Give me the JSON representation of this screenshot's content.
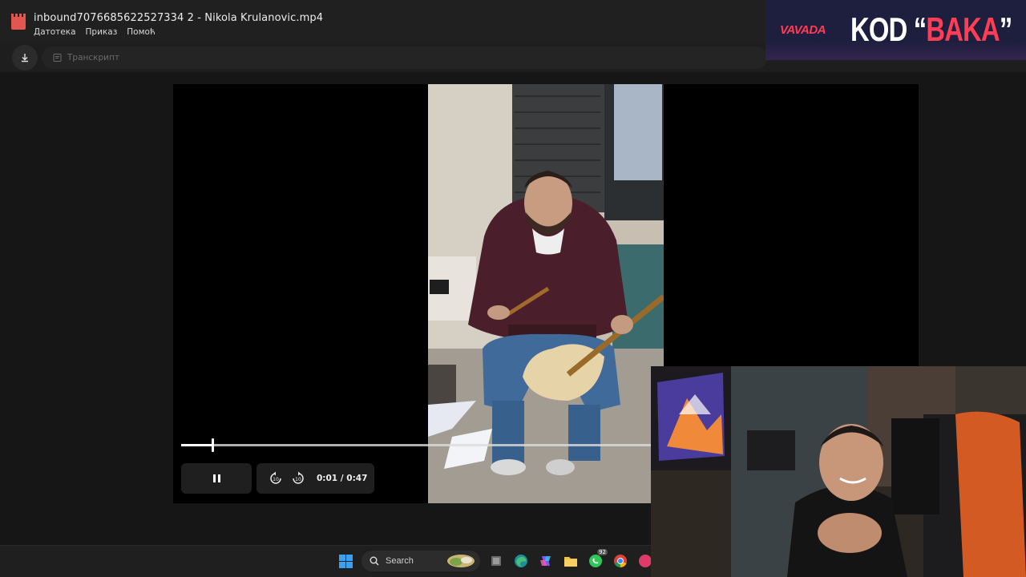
{
  "window": {
    "title": "inbound7076685622527334 2 - Nikola Krulanovic.mp4",
    "menu": [
      "Датотека",
      "Приказ",
      "Помоћ"
    ]
  },
  "toolbar": {
    "transcript_label": "Транскрипт"
  },
  "player": {
    "current_time": "0:01",
    "duration": "0:47",
    "time_display": "0:01 / 0:47",
    "progress_fraction": 0.067,
    "skip_back_icon": "replay-10-icon",
    "skip_forward_icon": "forward-10-icon",
    "state": "playing"
  },
  "taskbar": {
    "search_label": "Search",
    "badge_count": "92"
  },
  "banner": {
    "brand": "VAVADA",
    "code_prefix": "KOD “",
    "code_word": "BAKA",
    "code_suffix": "”"
  },
  "colors": {
    "brand_red": "#ff3d55",
    "banner_bg": "#1e1f3e",
    "progress": "#ffffff"
  }
}
